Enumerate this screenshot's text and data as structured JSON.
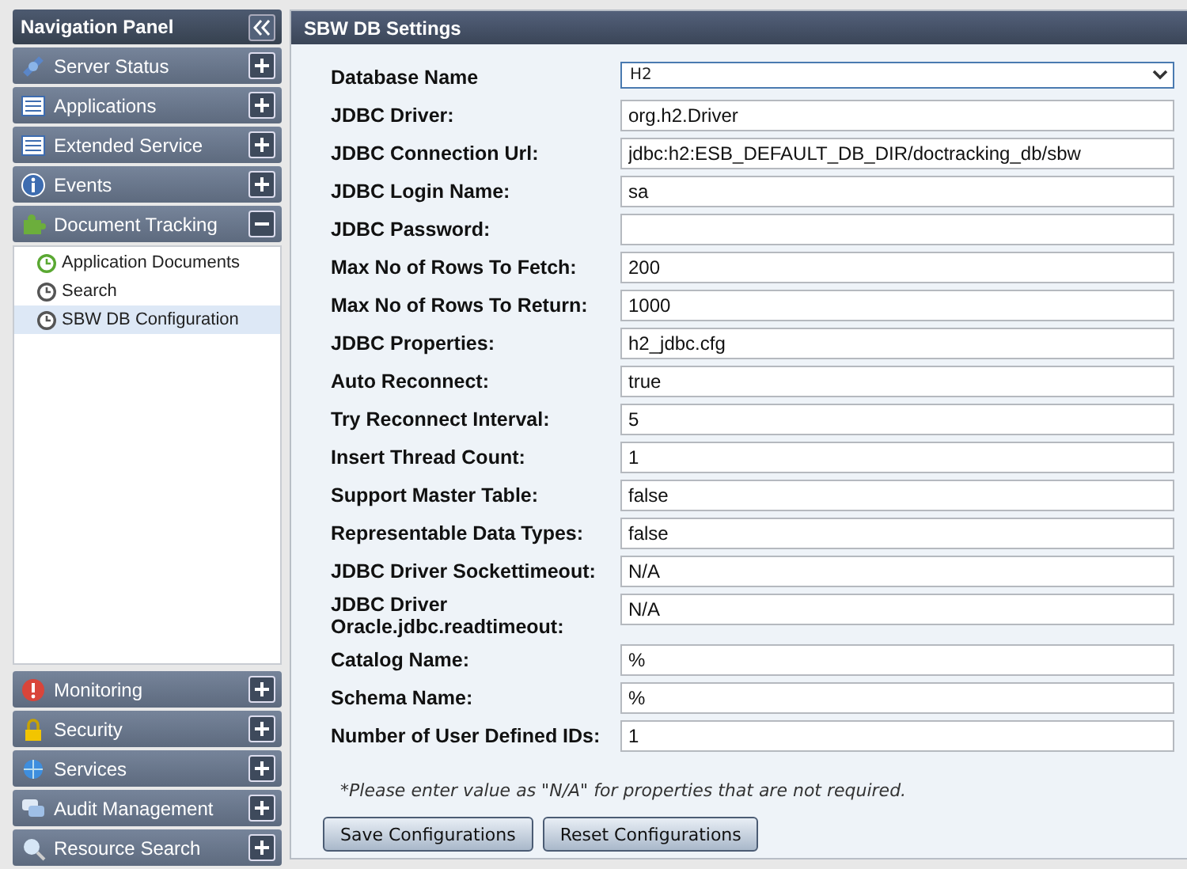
{
  "navigation": {
    "title": "Navigation Panel",
    "sections_top": [
      {
        "label": "Server Status",
        "expanded": false
      },
      {
        "label": "Applications",
        "expanded": false
      },
      {
        "label": "Extended Service",
        "expanded": false
      },
      {
        "label": "Events",
        "expanded": false
      },
      {
        "label": "Document Tracking",
        "expanded": true,
        "children": [
          {
            "label": "Application Documents",
            "selected": false
          },
          {
            "label": "Search",
            "selected": false
          },
          {
            "label": "SBW DB Configuration",
            "selected": true
          }
        ]
      }
    ],
    "sections_bottom": [
      {
        "label": "Monitoring",
        "expanded": false
      },
      {
        "label": "Security",
        "expanded": false
      },
      {
        "label": "Services",
        "expanded": false
      },
      {
        "label": "Audit Management",
        "expanded": false
      },
      {
        "label": "Resource Search",
        "expanded": false
      }
    ]
  },
  "settings": {
    "title": "SBW DB Settings",
    "fields": [
      {
        "kind": "select",
        "label": "Database Name",
        "value": "H2"
      },
      {
        "kind": "text",
        "label": "JDBC Driver:",
        "value": "org.h2.Driver"
      },
      {
        "kind": "text",
        "label": "JDBC Connection Url:",
        "value": "jdbc:h2:ESB_DEFAULT_DB_DIR/doctracking_db/sbw"
      },
      {
        "kind": "text",
        "label": "JDBC Login Name:",
        "value": "sa"
      },
      {
        "kind": "text",
        "label": "JDBC Password:"
      },
      {
        "kind": "text",
        "label": "Max No of Rows To Fetch:",
        "value": "200"
      },
      {
        "kind": "text",
        "label": "Max No of Rows To Return:",
        "value": "1000"
      },
      {
        "kind": "text",
        "label": "JDBC Properties:",
        "value": "h2_jdbc.cfg"
      },
      {
        "kind": "text",
        "label": "Auto Reconnect:",
        "value": "true"
      },
      {
        "kind": "text",
        "label": "Try Reconnect Interval:",
        "value": "5"
      },
      {
        "kind": "text",
        "label": "Insert Thread Count:",
        "value": "1"
      },
      {
        "kind": "text",
        "label": "Support Master Table:",
        "value": "false"
      },
      {
        "kind": "text",
        "label": "Representable Data Types:",
        "value": "false"
      },
      {
        "kind": "text",
        "label": "JDBC Driver Sockettimeout:",
        "value": "N/A"
      },
      {
        "kind": "text",
        "label": "JDBC Driver Oracle.jdbc.readtimeout:",
        "value": "N/A"
      },
      {
        "kind": "text",
        "label": "Catalog Name:",
        "value": "%"
      },
      {
        "kind": "text",
        "label": "Schema Name:",
        "value": "%"
      },
      {
        "kind": "text",
        "label": "Number of User Defined IDs:",
        "value": "1"
      }
    ],
    "note": "*Please enter value as \"N/A\" for properties that are not required.",
    "buttons": [
      "Save Configurations",
      "Reset Configurations"
    ]
  }
}
